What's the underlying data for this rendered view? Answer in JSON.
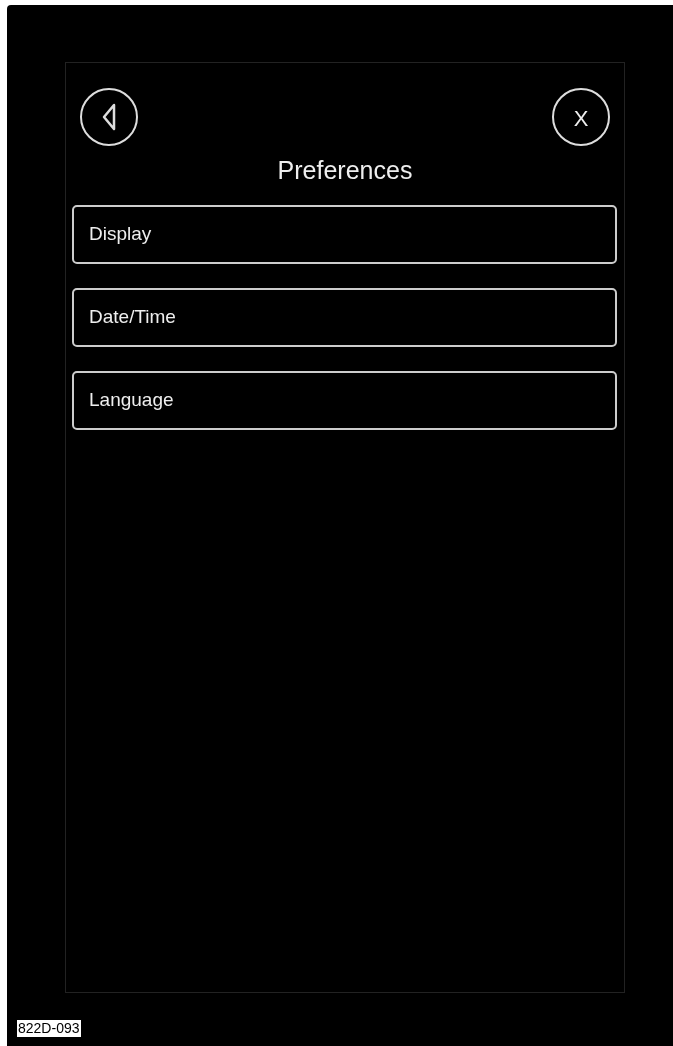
{
  "header": {
    "close_label": "X",
    "title": "Preferences"
  },
  "menu_items": [
    {
      "label": "Display"
    },
    {
      "label": "Date/Time"
    },
    {
      "label": "Language"
    }
  ],
  "figure_label": "822D-093"
}
